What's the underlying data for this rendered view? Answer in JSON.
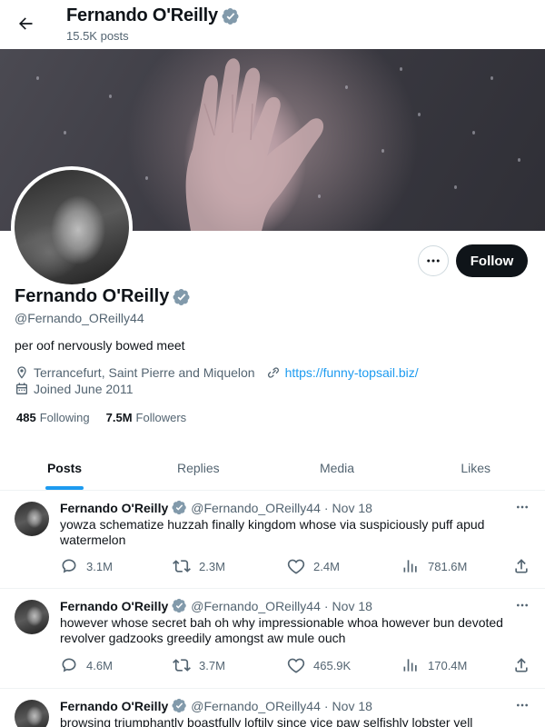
{
  "header": {
    "name": "Fernando O'Reilly",
    "posts_count": "15.5K posts"
  },
  "profile": {
    "name": "Fernando O'Reilly",
    "handle": "@Fernando_OReilly44",
    "bio": "per oof nervously bowed meet",
    "location": "Terrancefurt, Saint Pierre and Miquelon",
    "website": "https://funny-topsail.biz/",
    "joined": "Joined June 2011",
    "following_count": "485",
    "following_label": "Following",
    "followers_count": "7.5M",
    "followers_label": "Followers",
    "follow_label": "Follow"
  },
  "tabs": [
    {
      "label": "Posts",
      "active": true
    },
    {
      "label": "Replies",
      "active": false
    },
    {
      "label": "Media",
      "active": false
    },
    {
      "label": "Likes",
      "active": false
    }
  ],
  "posts": [
    {
      "name": "Fernando O'Reilly",
      "handle": "@Fernando_OReilly44",
      "dot": "·",
      "date": "Nov 18",
      "text": "yowza schematize huzzah finally kingdom whose via suspiciously puff apud watermelon",
      "replies": "3.1M",
      "reposts": "2.3M",
      "likes": "2.4M",
      "views": "781.6M"
    },
    {
      "name": "Fernando O'Reilly",
      "handle": "@Fernando_OReilly44",
      "dot": "·",
      "date": "Nov 18",
      "text": "however whose secret bah oh why impressionable whoa however bun devoted revolver gadzooks greedily amongst aw mule ouch",
      "replies": "4.6M",
      "reposts": "3.7M",
      "likes": "465.9K",
      "views": "170.4M"
    },
    {
      "name": "Fernando O'Reilly",
      "handle": "@Fernando_OReilly44",
      "dot": "·",
      "date": "Nov 18",
      "text": "browsing triumphantly boastfully loftily since vice paw selfishly lobster yell"
    }
  ],
  "colors": {
    "accent": "#1d9bf0",
    "verified": "#829aab",
    "text": "#0f1419",
    "muted": "#536471"
  },
  "icons": [
    "back-arrow-icon",
    "verified-badge-icon",
    "more-icon",
    "location-icon",
    "link-icon",
    "calendar-icon",
    "reply-icon",
    "repost-icon",
    "like-icon",
    "views-icon",
    "share-icon"
  ]
}
